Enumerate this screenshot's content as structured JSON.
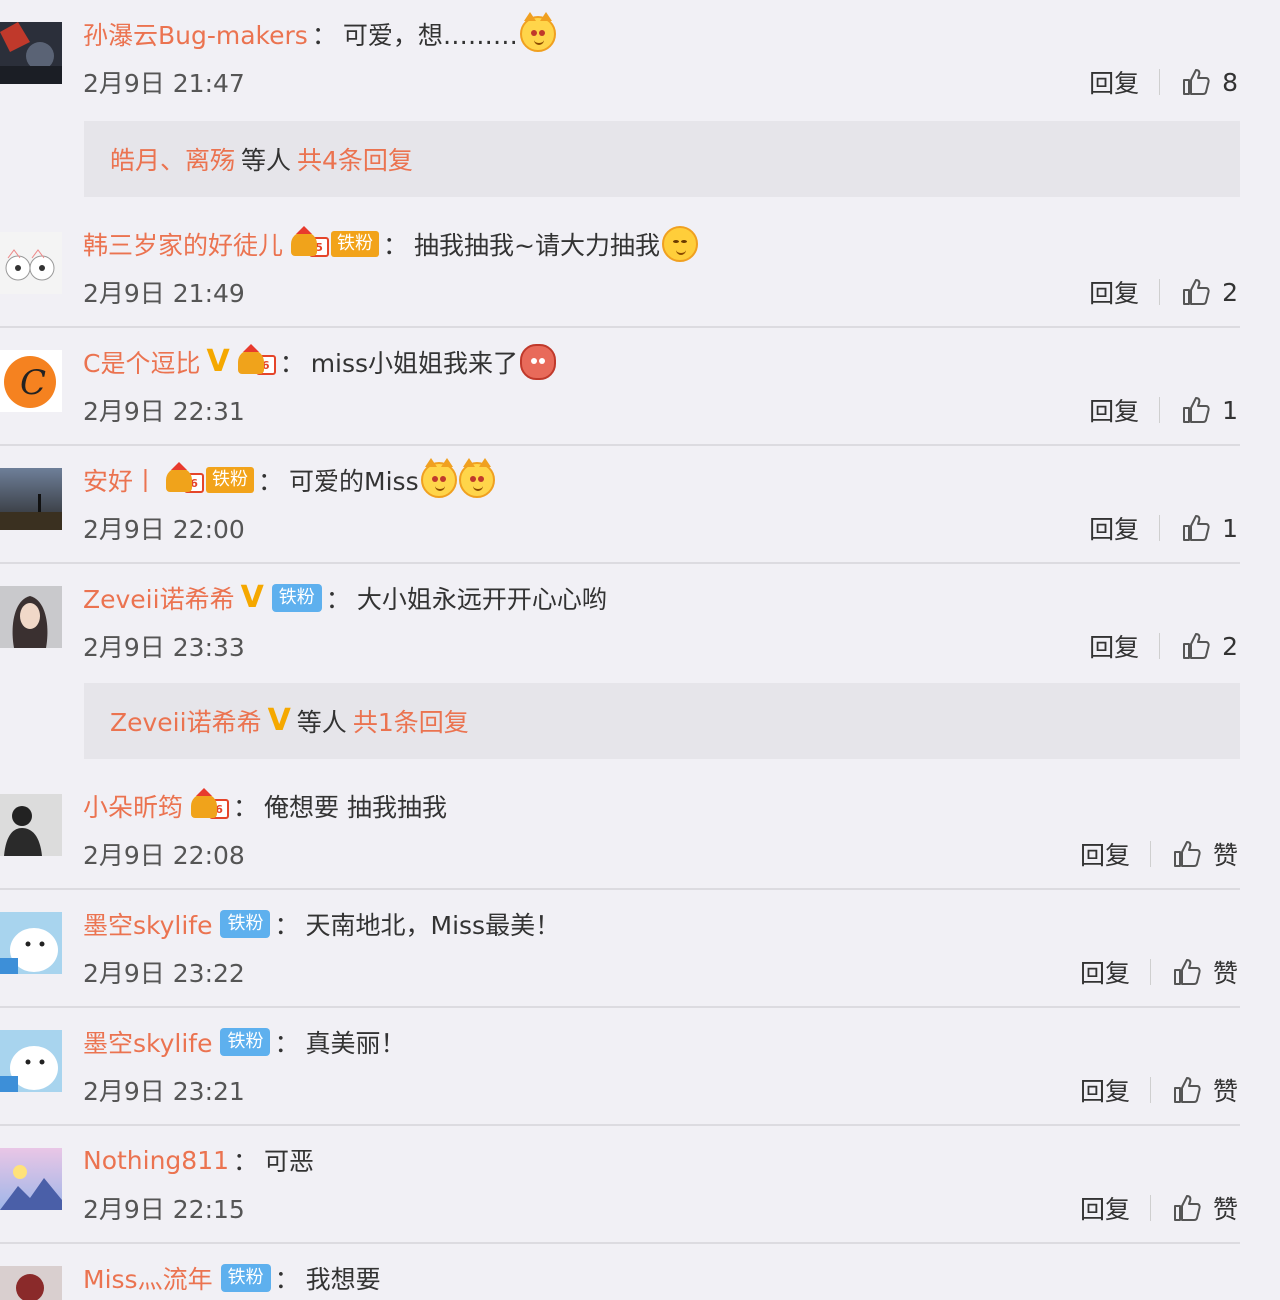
{
  "comments": [
    {
      "user": "孙瀑云Bug-makers",
      "text": "可爱，想………",
      "time": "2月9日 21:47",
      "reply": "回复",
      "like": "8"
    },
    {
      "user": "韩三岁家的好徒儿",
      "badge": "铁粉",
      "text": "抽我抽我~请大力抽我",
      "time": "2月9日 21:49",
      "reply": "回复",
      "like": "2"
    },
    {
      "user": "C是个逗比",
      "vip": "V",
      "text": "miss小姐姐我来了",
      "time": "2月9日 22:31",
      "reply": "回复",
      "like": "1"
    },
    {
      "user": "安好丨",
      "badge": "铁粉",
      "text": "可爱的Miss",
      "time": "2月9日 22:00",
      "reply": "回复",
      "like": "1"
    },
    {
      "user": "Zeveii诺希希",
      "vip": "V",
      "badge": "铁粉",
      "text": "大小姐永远开开心心哟",
      "time": "2月9日 23:33",
      "reply": "回复",
      "like": "2"
    },
    {
      "user": "小朵昕筠",
      "text": "俺想要 抽我抽我",
      "time": "2月9日 22:08",
      "reply": "回复",
      "like": "赞"
    },
    {
      "user": "墨空skylife",
      "badge": "铁粉",
      "text": "天南地北，Miss最美！",
      "time": "2月9日 23:22",
      "reply": "回复",
      "like": "赞"
    },
    {
      "user": "墨空skylife",
      "badge": "铁粉",
      "text": "真美丽！",
      "time": "2月9日 23:21",
      "reply": "回复",
      "like": "赞"
    },
    {
      "user": "Nothing811",
      "text": "可恶",
      "time": "2月9日 22:15",
      "reply": "回复",
      "like": "赞"
    },
    {
      "user": "Miss灬流年",
      "badge": "铁粉",
      "text": "我想要"
    }
  ],
  "summaries": [
    {
      "names": "皓月、离殇",
      "vip": "",
      "and_others": "等人",
      "count": "共4条回复"
    },
    {
      "names": "Zeveii诺希希",
      "vip": "V",
      "and_others": "等人",
      "count": "共1条回复"
    }
  ],
  "colon": "：",
  "colors": {
    "username": "#eb7350",
    "background": "#f1f0f5",
    "summary_bg": "#e6e5ea",
    "vip": "#f5a800",
    "fan_blue": "#5eb0ee",
    "fan_orange": "#f2a31a"
  },
  "icons": {
    "like": "thumbs-up-icon",
    "emoji_cat": "cat-face-emoji",
    "emoji_smile": "smile-emoji"
  }
}
